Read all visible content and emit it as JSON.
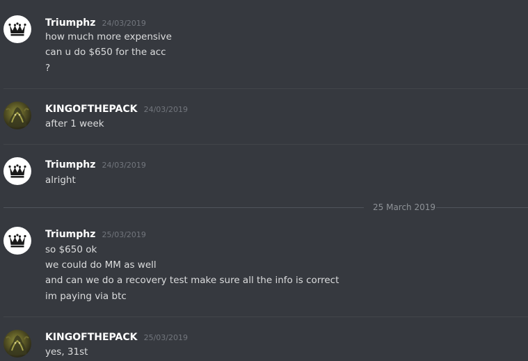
{
  "date_separator": "25 March 2019",
  "messages": [
    {
      "username": "Triumphz",
      "avatar": "crown-icon",
      "timestamp": "24/03/2019",
      "lines": [
        "how much more expensive",
        "can u do $650 for the acc",
        "?"
      ]
    },
    {
      "username": "KINGOFTHEPACK",
      "avatar": "wolf-avatar",
      "timestamp": "24/03/2019",
      "lines": [
        "after 1 week"
      ]
    },
    {
      "username": "Triumphz",
      "avatar": "crown-icon",
      "timestamp": "24/03/2019",
      "lines": [
        "alright"
      ]
    },
    {
      "username": "Triumphz",
      "avatar": "crown-icon",
      "timestamp": "25/03/2019",
      "lines": [
        "so $650 ok",
        "we could do MM as well",
        "and can we do a recovery test make sure all the info is correct",
        "im paying via btc"
      ]
    },
    {
      "username": "KINGOFTHEPACK",
      "avatar": "wolf-avatar",
      "timestamp": "25/03/2019",
      "lines": [
        "yes, 31st"
      ]
    }
  ],
  "colors": {
    "background": "#36393f",
    "username": "#ffffff",
    "timestamp": "#72767d",
    "message_text": "#dcddde",
    "divider": "#42454a"
  }
}
